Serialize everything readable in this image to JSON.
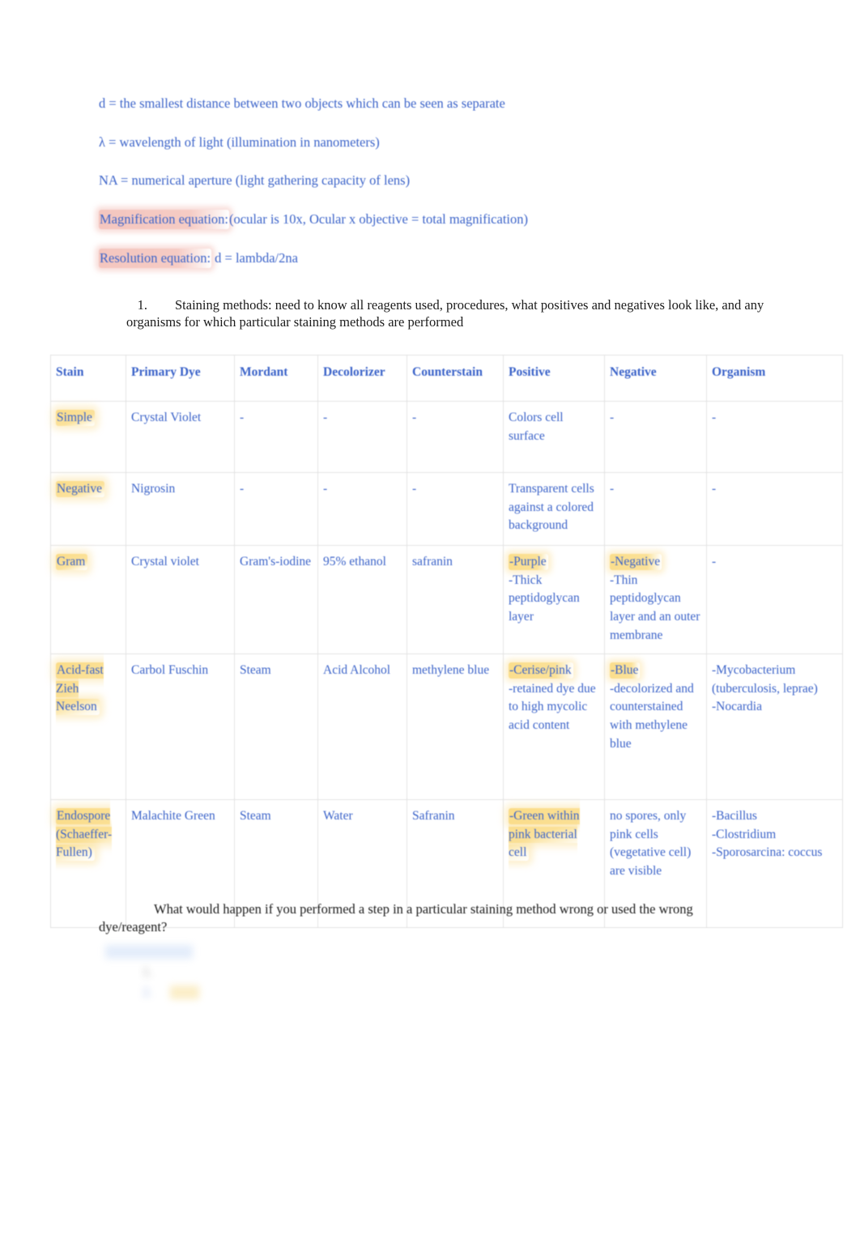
{
  "definitions": [
    {
      "text": "d = the smallest distance between two objects which can be seen as separate",
      "highlight": "none"
    },
    {
      "text": "λ = wavelength of light (illumination in nanometers)",
      "highlight": "none"
    },
    {
      "text": "NA = numerical aperture (light gathering capacity of lens)",
      "highlight": "none"
    },
    {
      "label": "Magnification equation:",
      "rest": "(ocular is 10x, Ocular x objective = total magnification)",
      "highlight": "pink"
    },
    {
      "label": "Resolution equation:",
      "rest": " d = lambda/2na",
      "highlight": "pink"
    }
  ],
  "numbered_item": {
    "marker": "1.",
    "text": "Staining methods: need to know all reagents used, procedures, what positives and negatives look like, and any organisms for which particular staining methods are performed"
  },
  "table": {
    "headers": [
      "Stain",
      "Primary Dye",
      "Mordant",
      "Decolorizer",
      "Counterstain",
      "Positive",
      "Negative",
      "Organism"
    ],
    "rows": [
      {
        "stain": [
          "Simple"
        ],
        "primary_dye": [
          "Crystal Violet"
        ],
        "mordant": [
          "-"
        ],
        "decolorizer": [
          "-"
        ],
        "counterstain": [
          "-"
        ],
        "positive": [
          "Colors cell surface"
        ],
        "negative": [
          "-"
        ],
        "organism": [
          "-"
        ]
      },
      {
        "stain": [
          "Negative"
        ],
        "primary_dye": [
          "Nigrosin"
        ],
        "mordant": [
          "-"
        ],
        "decolorizer": [
          "-"
        ],
        "counterstain": [
          "-"
        ],
        "positive": [
          "Transparent cells against a colored background"
        ],
        "negative": [
          "-"
        ],
        "organism": [
          "-"
        ]
      },
      {
        "stain": [
          "Gram"
        ],
        "primary_dye": [
          "Crystal violet"
        ],
        "mordant": [
          "Gram's-iodine"
        ],
        "decolorizer": [
          "95% ethanol"
        ],
        "counterstain": [
          "safranin"
        ],
        "positive": [
          "-Purple",
          "-Thick peptidoglycan layer"
        ],
        "negative": [
          "-Negative",
          "-Thin peptidoglycan layer and an outer membrane"
        ],
        "organism": [
          "-"
        ]
      },
      {
        "stain": [
          "Acid-fast Zieh Neelson"
        ],
        "primary_dye": [
          "Carbol Fuschin"
        ],
        "mordant": [
          "Steam"
        ],
        "decolorizer": [
          "Acid Alcohol"
        ],
        "counterstain": [
          "methylene blue"
        ],
        "positive": [
          "-Cerise/pink",
          "-retained dye due to high mycolic acid content"
        ],
        "negative": [
          "-Blue",
          "-decolorized and counterstained with methylene blue"
        ],
        "organism": [
          "-Mycobacterium (tuberculosis, leprae)",
          "-Nocardia"
        ]
      },
      {
        "stain": [
          "Endospore (Schaeffer-Fullen)"
        ],
        "primary_dye": [
          "Malachite Green"
        ],
        "mordant": [
          "Steam"
        ],
        "decolorizer": [
          "Water"
        ],
        "counterstain": [
          "Safranin"
        ],
        "positive": [
          "-Green within pink bacterial cell"
        ],
        "negative": [
          "no spores, only pink cells (vegetative cell) are visible"
        ],
        "organism": [
          "-Bacillus",
          "-Clostridium",
          "-Sporosarcina: coccus"
        ]
      }
    ]
  },
  "closing_paragraph": "What would happen if you performed a step in a particular staining method wrong or used the wrong dye/reagent?",
  "obscured_block": {
    "note": "illegible blurred text",
    "lines": [
      {
        "text": "",
        "style": "blue-highlight"
      },
      {
        "marker": "",
        "text": "",
        "style": "dark"
      },
      {
        "marker": "",
        "text": "",
        "style": "blue"
      }
    ]
  },
  "colors": {
    "body_text": "#1b1b1b",
    "accent_blue": "#3b63c9",
    "highlight_yellow": "#fad87c",
    "highlight_pink": "#f0b0a6",
    "table_border": "#e3e3e3",
    "page_background": "#ffffff"
  }
}
